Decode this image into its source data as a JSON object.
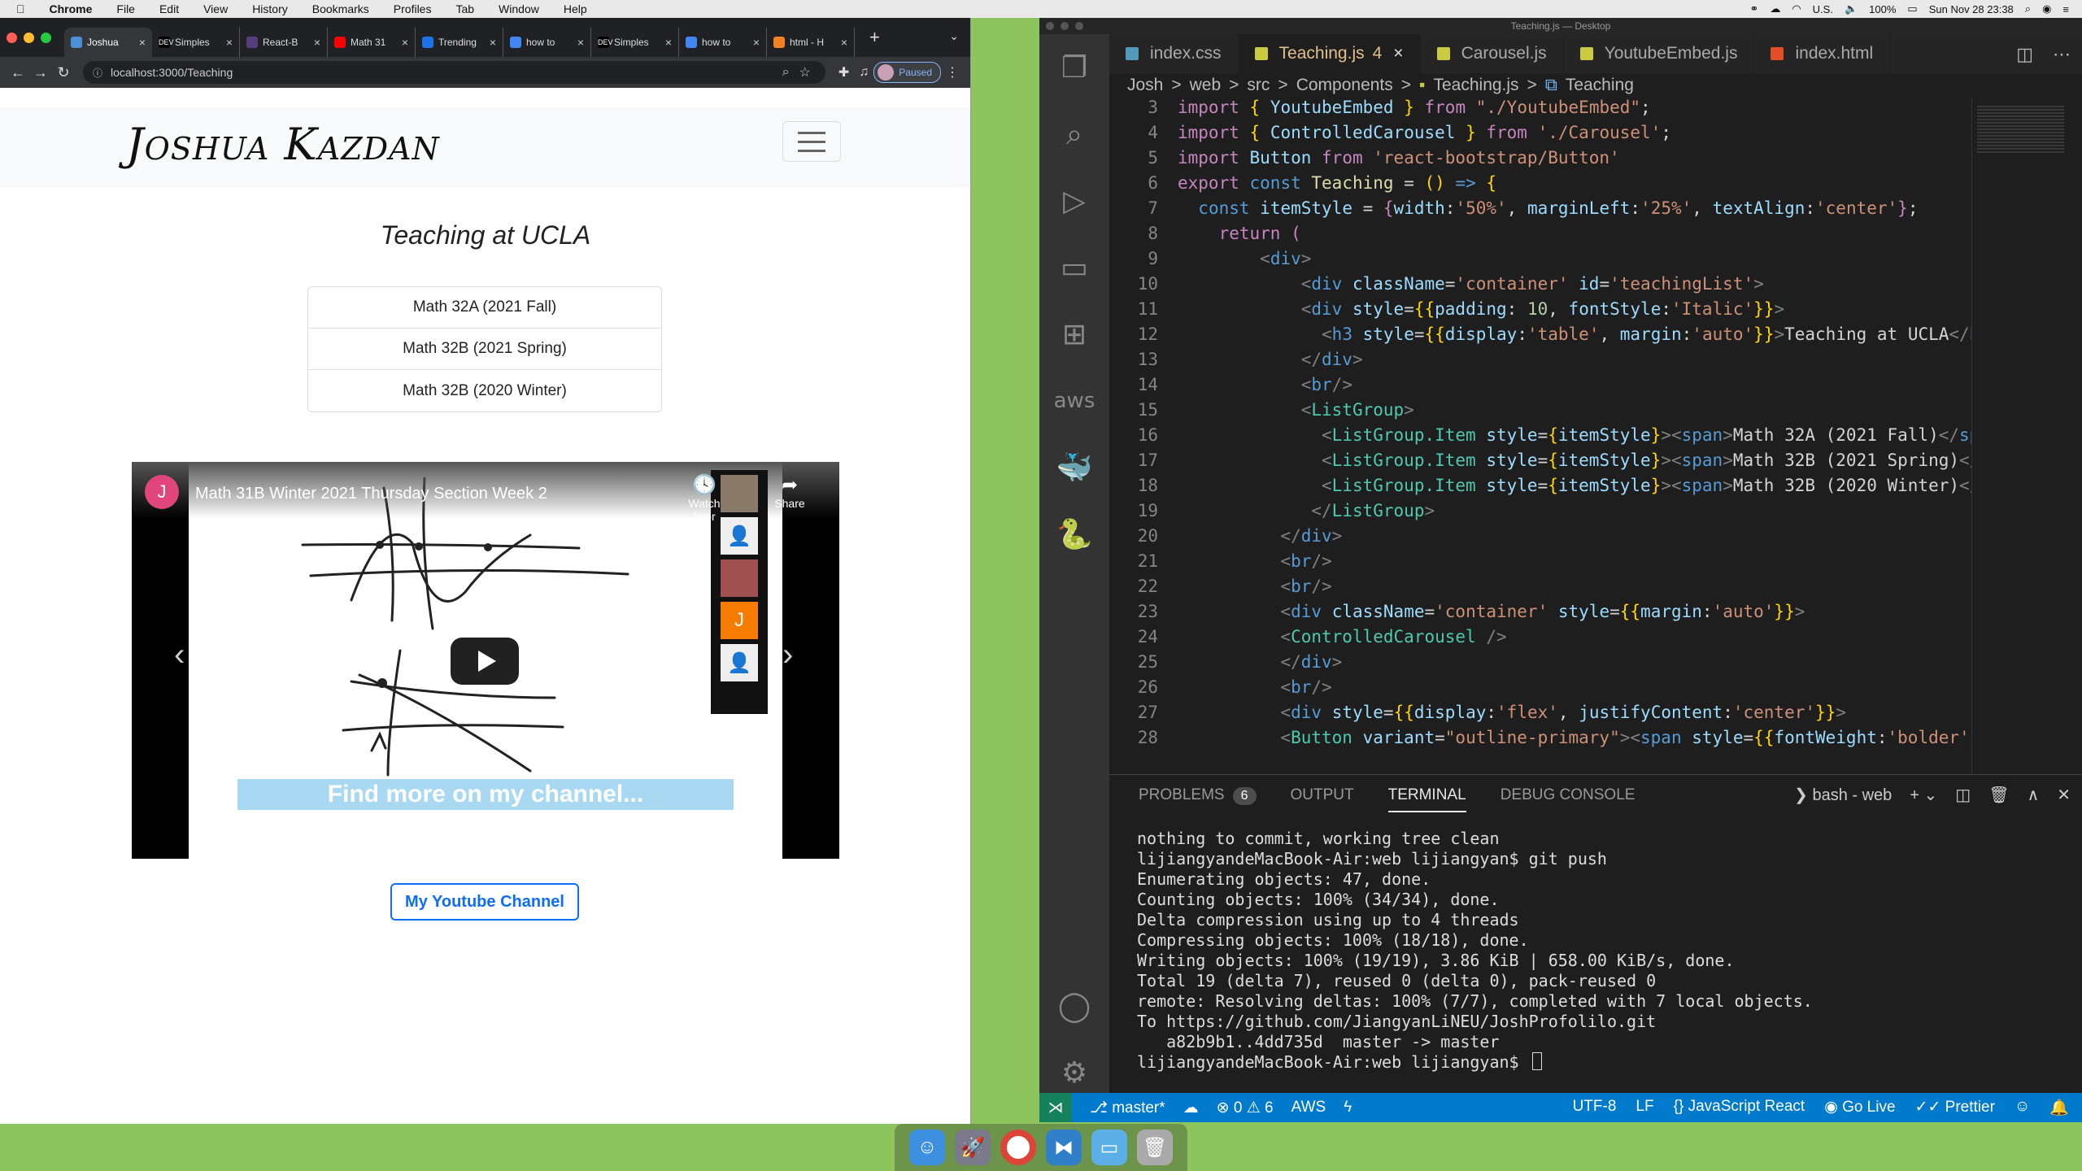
{
  "menubar": {
    "apple": "",
    "app": "Chrome",
    "items": [
      "File",
      "Edit",
      "View",
      "History",
      "Bookmarks",
      "Profiles",
      "Tab",
      "Window",
      "Help"
    ],
    "locale": "U.S.",
    "battery": "100%",
    "datetime": "Sun Nov 28  23:38"
  },
  "chrome": {
    "tabs": [
      {
        "label": "Joshua",
        "favicon_color": "#4a90d9",
        "active": true
      },
      {
        "label": "Simples",
        "favicon_color": "#000000",
        "favicon_text": "DEV"
      },
      {
        "label": "React-B",
        "favicon_color": "#563d7c"
      },
      {
        "label": "Math 31",
        "favicon_color": "#ff0000"
      },
      {
        "label": "Trending",
        "favicon_color": "#1a73e8"
      },
      {
        "label": "how to",
        "favicon_color": "#4285f4"
      },
      {
        "label": "Simples",
        "favicon_color": "#000000",
        "favicon_text": "DEV"
      },
      {
        "label": "how to",
        "favicon_color": "#4285f4"
      },
      {
        "label": "html - H",
        "favicon_color": "#f48024"
      }
    ],
    "close_glyph": "×",
    "new_tab": "+",
    "url": "localhost:3000/Teaching",
    "profile_status": "Paused"
  },
  "site": {
    "brand": "Joshua Kazdan",
    "teaching_title": "Teaching at UCLA",
    "courses": [
      "Math 32A (2021 Fall)",
      "Math 32B (2021 Spring)",
      "Math 32B (2020 Winter)"
    ],
    "video": {
      "avatar_letter": "J",
      "title": "Math 31B Winter 2021 Thursday Section Week 2",
      "watch_later": "Watch later",
      "share": "Share",
      "banner": "Find more on my channel...",
      "participant_letter": "J"
    },
    "youtube_button": "My Youtube Channel"
  },
  "vscode": {
    "window_title": "Teaching.js — Desktop",
    "tabs": [
      {
        "label": "index.css",
        "icon_color": "#519aba"
      },
      {
        "label": "Teaching.js",
        "badge": "4",
        "icon_color": "#cbcb41",
        "active": true
      },
      {
        "label": "Carousel.js",
        "icon_color": "#cbcb41"
      },
      {
        "label": "YoutubeEmbed.js",
        "icon_color": "#cbcb41"
      },
      {
        "label": "index.html",
        "icon_color": "#e44d26"
      }
    ],
    "close_glyph": "×",
    "breadcrumb": [
      "Josh",
      "web",
      "src",
      "Components",
      "Teaching.js",
      "Teaching"
    ],
    "breadcrumb_sep": ">",
    "line_numbers": [
      "3",
      "4",
      "5",
      "6",
      "7",
      "8",
      "9",
      "10",
      "11",
      "12",
      "13",
      "14",
      "15",
      "16",
      "17",
      "18",
      "19",
      "20",
      "21",
      "22",
      "23",
      "24",
      "25",
      "26",
      "27",
      "28"
    ],
    "panel": {
      "tabs": [
        "PROBLEMS",
        "OUTPUT",
        "TERMINAL",
        "DEBUG CONSOLE"
      ],
      "problems_count": "6",
      "shell": "bash - web"
    },
    "terminal": [
      "nothing to commit, working tree clean",
      "lijiangyandeMacBook-Air:web lijiangyan$ git push",
      "Enumerating objects: 47, done.",
      "Counting objects: 100% (34/34), done.",
      "Delta compression using up to 4 threads",
      "Compressing objects: 100% (18/18), done.",
      "Writing objects: 100% (19/19), 3.86 KiB | 658.00 KiB/s, done.",
      "Total 19 (delta 7), reused 0 (delta 0), pack-reused 0",
      "remote: Resolving deltas: 100% (7/7), completed with 7 local objects.",
      "To https://github.com/JiangyanLiNEU/JoshProfolilo.git",
      "   a82b9b1..4dd735d  master -> master",
      "lijiangyandeMacBook-Air:web lijiangyan$ "
    ],
    "status": {
      "branch": "master*",
      "errors": "0",
      "warnings": "6",
      "aws": "AWS",
      "encoding": "UTF-8",
      "eol": "LF",
      "language": "JavaScript React",
      "golive": "Go Live",
      "prettier": "Prettier"
    }
  },
  "dock": {
    "apps": [
      "finder-icon",
      "launchpad-icon",
      "chrome-icon",
      "vscode-icon",
      "folder-icon",
      "trash-icon"
    ]
  }
}
